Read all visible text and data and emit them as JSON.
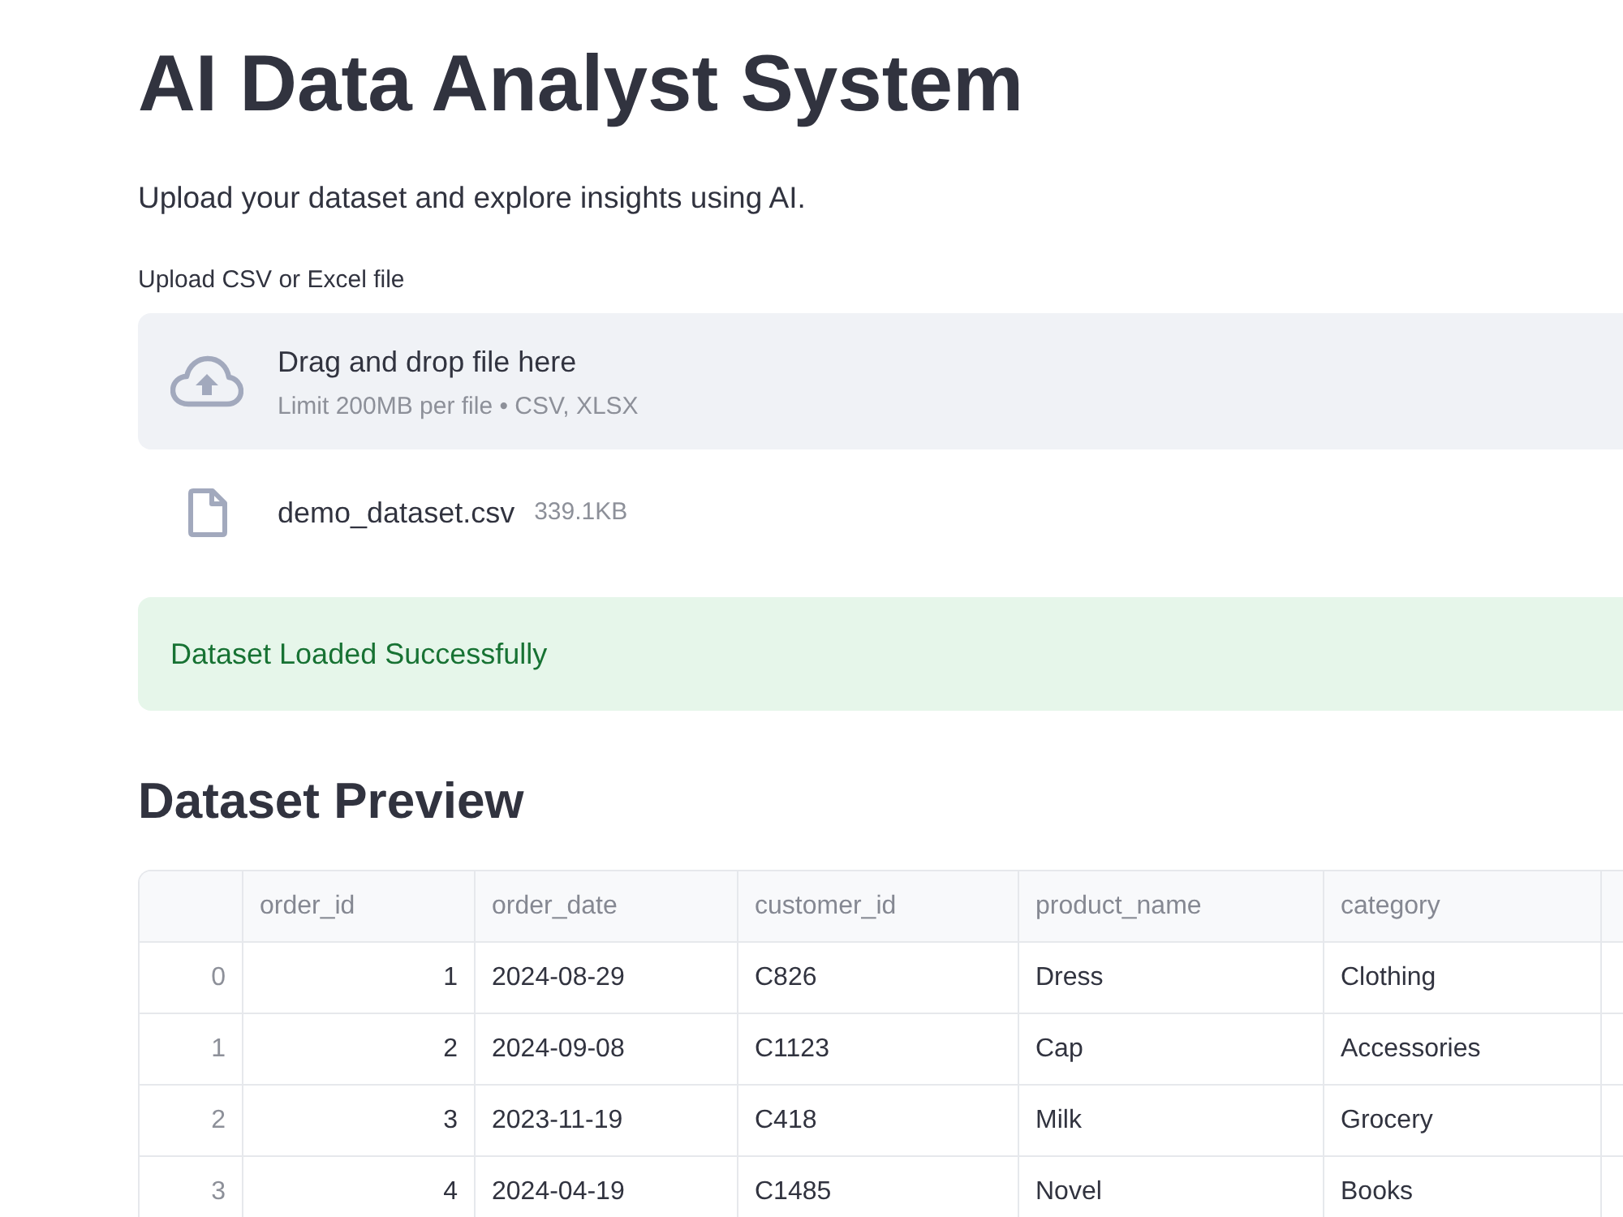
{
  "title": "AI Data Analyst System",
  "subtitle": "Upload your dataset and explore insights using AI.",
  "uploader": {
    "label": "Upload CSV or Excel file",
    "dropzone_title": "Drag and drop file here",
    "dropzone_hint": "Limit 200MB per file • CSV, XLSX",
    "file": {
      "name": "demo_dataset.csv",
      "size": "339.1KB"
    }
  },
  "alert": {
    "kind": "success",
    "message": "Dataset Loaded Successfully"
  },
  "preview": {
    "heading": "Dataset Preview",
    "table": {
      "columns": [
        {
          "label": "order_id",
          "kind": "number"
        },
        {
          "label": "order_date",
          "kind": "text"
        },
        {
          "label": "customer_id",
          "kind": "text"
        },
        {
          "label": "product_name",
          "kind": "text"
        },
        {
          "label": "category",
          "kind": "text"
        }
      ],
      "rows": [
        {
          "index": "0",
          "cells": [
            "1",
            "2024-08-29",
            "C826",
            "Dress",
            "Clothing"
          ]
        },
        {
          "index": "1",
          "cells": [
            "2",
            "2024-09-08",
            "C1123",
            "Cap",
            "Accessories"
          ]
        },
        {
          "index": "2",
          "cells": [
            "3",
            "2023-11-19",
            "C418",
            "Milk",
            "Grocery"
          ]
        },
        {
          "index": "3",
          "cells": [
            "4",
            "2024-04-19",
            "C1485",
            "Novel",
            "Books"
          ]
        }
      ]
    }
  }
}
